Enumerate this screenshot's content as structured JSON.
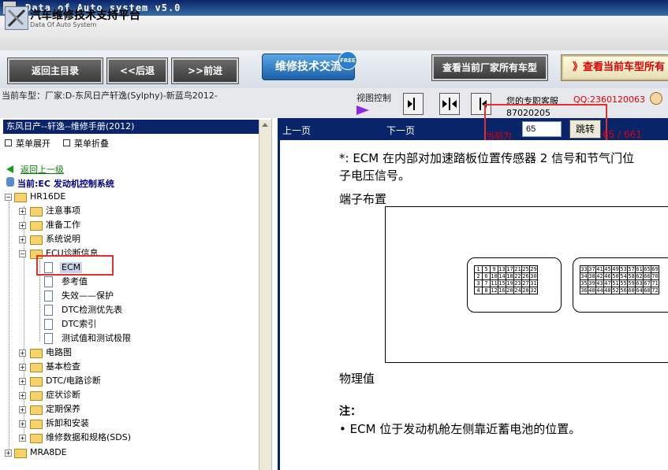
{
  "window": {
    "title": "Data of Auto system v5.0"
  },
  "header": {
    "title": "汽车维修技术支持平台",
    "subtitle": "Data Of Auto System"
  },
  "toolbar": {
    "home": "返回主目录",
    "back": "<<后退",
    "forward": ">>前进",
    "exchange": "维修技术交流",
    "exchange_badge": "FREE",
    "all_models": "查看当前厂家所有车型",
    "current_model": "》查看当前车型所有"
  },
  "infobar": {
    "current_car": "当前车型：厂家:D-东风日产轩逸(Sylphy)-新蓝鸟2012-",
    "view_control": "视图控制",
    "support_label": "您的专职客服",
    "support_qq": "QQ:2360120063",
    "support_num": "87020205"
  },
  "left": {
    "manual_title": "东风日产--轩逸--维修手册(2012)",
    "menu_expand": "菜单展开",
    "menu_collapse": "菜单折叠",
    "back_link": "返回上一级",
    "current": "当前:EC 发动机控制系统",
    "tree": {
      "root": "HR16DE",
      "items": [
        "注意事项",
        "准备工作",
        "系统说明",
        "ECU诊断信息"
      ],
      "ecu_children": [
        "ECM",
        "参考值",
        "失效——保护",
        "DTC检测优先表",
        "DTC索引",
        "测试值和测试极限"
      ],
      "items2": [
        "电路图",
        "基本检查",
        "DTC/电路诊断",
        "症状诊断",
        "定期保养",
        "拆卸和安装",
        "维修数据和规格(SDS)"
      ],
      "root2": "MRA8DE"
    }
  },
  "nav": {
    "prev": "上一页",
    "next": "下一页",
    "current_page_label": "当前为",
    "page_value": "65",
    "jump": "跳转",
    "page_total": "65 / 661"
  },
  "content": {
    "line1": "*: ECM 在内部对加速踏板位置传感器 2 信号和节气门位",
    "line2": "子电压信号。",
    "terminal_heading": "端子布置",
    "phys_heading": "物理值",
    "note_heading": "注：",
    "note_text": "ECM 位于发动机舱左侧靠近蓄电池的位置。",
    "connector1": [
      [
        "1",
        "5",
        "9",
        "13",
        "17",
        "21",
        "25",
        "29"
      ],
      [
        "2",
        "6",
        "10",
        "14",
        "18",
        "22",
        "26",
        "30"
      ],
      [
        "3",
        "7",
        "11",
        "15",
        "19",
        "23",
        "27",
        "31"
      ],
      [
        "4",
        "8",
        "12",
        "16",
        "20",
        "24",
        "28",
        "32"
      ]
    ],
    "connector2": [
      [
        "33",
        "37",
        "41",
        "45",
        "49",
        "53",
        "57",
        "61",
        "65",
        "69"
      ],
      [
        "34",
        "38",
        "42",
        "46",
        "50",
        "54",
        "58",
        "62",
        "66",
        "70"
      ],
      [
        "35",
        "39",
        "43",
        "47",
        "51",
        "55",
        "59",
        "63",
        "67",
        "71"
      ],
      [
        "36",
        "40",
        "44",
        "48",
        "52",
        "56",
        "60",
        "64",
        "68",
        "72"
      ]
    ]
  },
  "colors": {
    "nav_bar": "#0a246a",
    "highlight": "#e03030",
    "link_green": "#0a7a0a",
    "page_red": "#e00000"
  }
}
